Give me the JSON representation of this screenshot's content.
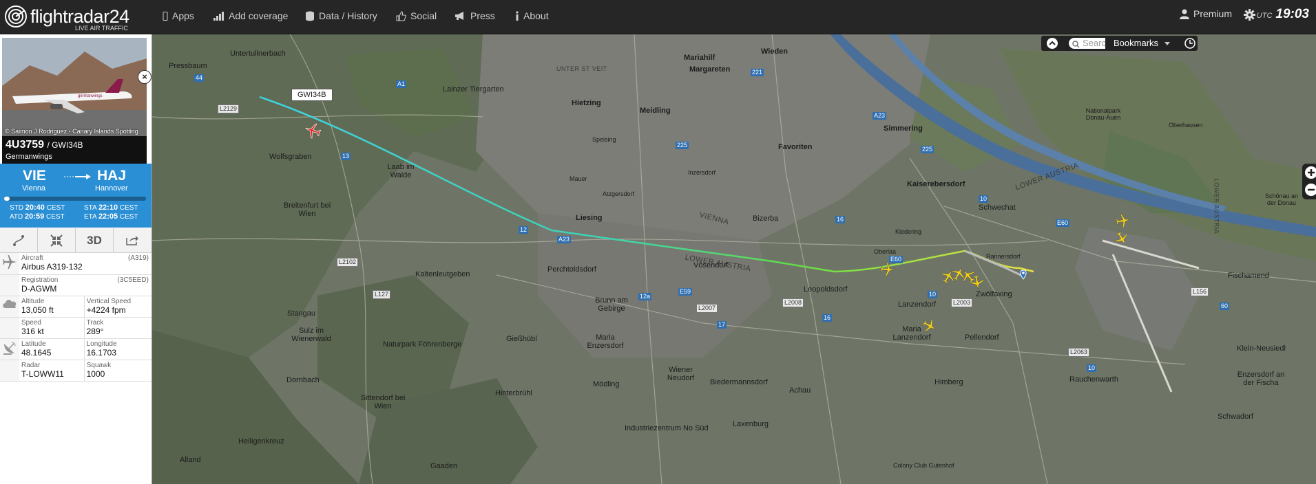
{
  "header": {
    "logo_text": "flightradar24",
    "logo_sub": "LIVE AIR TRAFFIC",
    "nav": [
      {
        "label": "Apps",
        "icon": "phone-icon"
      },
      {
        "label": "Add coverage",
        "icon": "signal-bars-icon"
      },
      {
        "label": "Data / History",
        "icon": "database-icon"
      },
      {
        "label": "Social",
        "icon": "thumbs-up-icon"
      },
      {
        "label": "Press",
        "icon": "megaphone-icon"
      },
      {
        "label": "About",
        "icon": "info-icon"
      }
    ],
    "premium_label": "Premium",
    "utc_label": "UTC",
    "utc_time": "19:03"
  },
  "flight": {
    "photo_credit": "© Saimon J Rodriguez - Canary Islands Spotting",
    "number": "4U3759",
    "callsign": "/ GWI34B",
    "airline": "Germanwings",
    "from_code": "VIE",
    "from_city": "Vienna",
    "to_code": "HAJ",
    "to_city": "Hannover",
    "progress": 0.04,
    "std_label": "STD",
    "std": "20:40",
    "atd_label": "ATD",
    "atd": "20:59",
    "sta_label": "STA",
    "sta": "22:10",
    "eta_label": "ETA",
    "eta": "22:05",
    "tz": "CEST",
    "tool_3d": "3D",
    "details": {
      "aircraft_label": "Aircraft",
      "aircraft_code": "(A319)",
      "aircraft": "Airbus A319-132",
      "registration_label": "Registration",
      "registration_hex": "(3C5EED)",
      "registration": "D-AGWM",
      "altitude_label": "Altitude",
      "altitude": "13,050 ft",
      "vspeed_label": "Vertical Speed",
      "vspeed": "+4224 fpm",
      "speed_label": "Speed",
      "speed": "316 kt",
      "track_label": "Track",
      "track": "289°",
      "lat_label": "Latitude",
      "lat": "48.1645",
      "lon_label": "Longitude",
      "lon": "16.1703",
      "radar_label": "Radar",
      "radar": "T-LOWW11",
      "squawk_label": "Squawk",
      "squawk": "1000"
    }
  },
  "map": {
    "callout": "GWI34B",
    "search_placeholder": "Search",
    "bookmarks_label": "Bookmarks",
    "places": [
      "Untertullnerbach",
      "Pressbaum",
      "Wolfsgraben",
      "Laab im Walde",
      "Breitenfurt bei Wien",
      "Kaltenleutgeben",
      "Perchtoldsdorf",
      "Stangau",
      "Sulz im Wienerwald",
      "Naturpark Föhrenberge",
      "Gießhübl",
      "Brunn am Gebirge",
      "Maria Enzersdorf",
      "Mödling",
      "Hinterbrühl",
      "Sittendorf bei Wien",
      "Dornbach",
      "Heiligenkreuz",
      "Alland",
      "Gaaden",
      "Wiener Neudorf",
      "Biedermannsdorf",
      "Laxenburg",
      "Industriezentrum No Süd",
      "Achau",
      "Vösendorf",
      "Leopoldsdorf",
      "Maria Lanzendorf",
      "Lanzendorf",
      "Zwölfaxing",
      "Pellendorf",
      "Himberg",
      "Rauchenwarth",
      "Schwechat",
      "Bizerba",
      "Lainzer Tiergarten",
      "Hietzing",
      "Meidling",
      "Margareten",
      "Mariahilf",
      "Wieden",
      "Favoriten",
      "Simmering",
      "Kaiserebersdorf",
      "Liesing",
      "Fischamend",
      "Klein-Neusiedl",
      "Enzersdorf an der Fischa",
      "Schwadorf",
      "Nationalpark Donau-Auen",
      "Colony Club Gutenhof",
      "Oberlaa",
      "Kledering",
      "Rannersdorf",
      "Speising",
      "Mauer",
      "Atzgersdorf",
      "Inzersdorf",
      "Oberhausen",
      "Schönau an der Donau"
    ],
    "districts": [
      "LOWER AUSTRIA",
      "VIENNA",
      "LOWER AUSTRIA",
      "UNTER ST VEIT",
      "LOWER AUSTRIA"
    ]
  }
}
